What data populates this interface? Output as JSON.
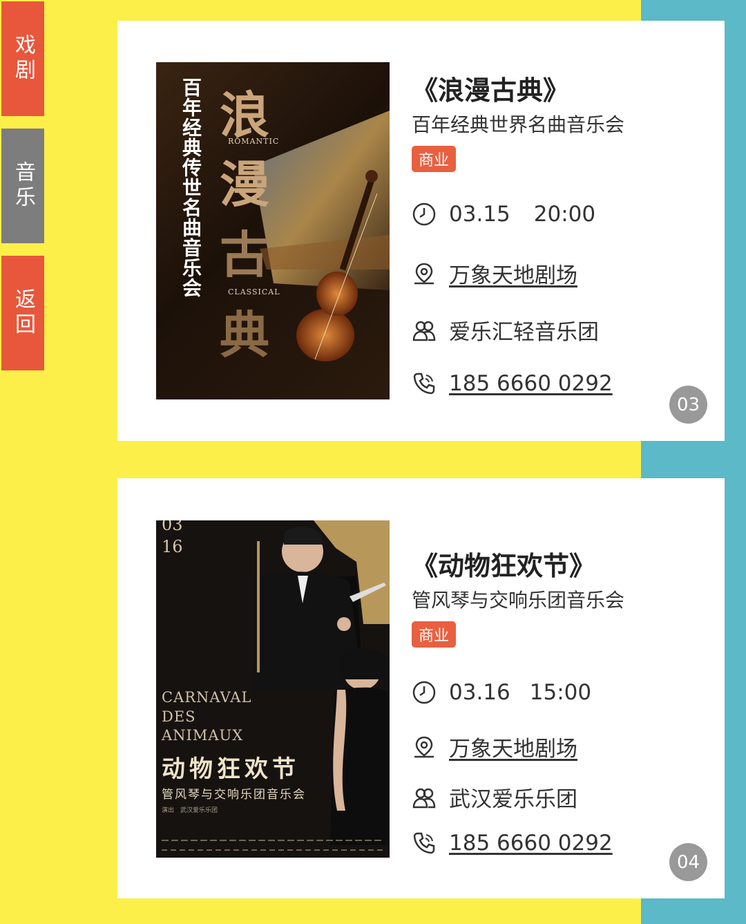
{
  "side_nav": {
    "drama": "戏剧",
    "music": "音乐",
    "back": "返回"
  },
  "events": [
    {
      "title": "《浪漫古典》",
      "subtitle": "百年经典世界名曲音乐会",
      "tag": "商业",
      "date": "03.15",
      "time": "20:00",
      "venue": "万象天地剧场",
      "performer": "爱乐汇轻音乐团",
      "phone": "185 6660 0292",
      "page": "03",
      "poster": {
        "vertical_title": "百年经典传世名曲音乐会",
        "big_chars": [
          "浪",
          "漫",
          "古",
          "典"
        ],
        "word_top": "ROMANTIC",
        "word_bottom": "CLASSICAL"
      }
    },
    {
      "title": "《动物狂欢节》",
      "subtitle": "管风琴与交响乐团音乐会",
      "tag": "商业",
      "date": "03.16",
      "time": "15:00",
      "venue": "万象天地剧场",
      "performer": "武汉爱乐乐团",
      "phone": "185 6660 0292",
      "page": "04",
      "poster": {
        "date_top": "03",
        "date_day": "16",
        "en_1": "CARNAVAL",
        "en_2": "DES",
        "en_3": "ANIMAUX",
        "cn_title": "动物狂欢节",
        "cn_sub": "管风琴与交响乐团音乐会",
        "cn_small": "演出　武汉爱乐乐团"
      }
    }
  ],
  "colors": {
    "background": "#fdef49",
    "accent_teal": "#5bb9c8",
    "tab_red": "#e8573c",
    "tab_gray": "#7d7d7d",
    "tag_red": "#e86040",
    "page_badge": "#999999"
  }
}
